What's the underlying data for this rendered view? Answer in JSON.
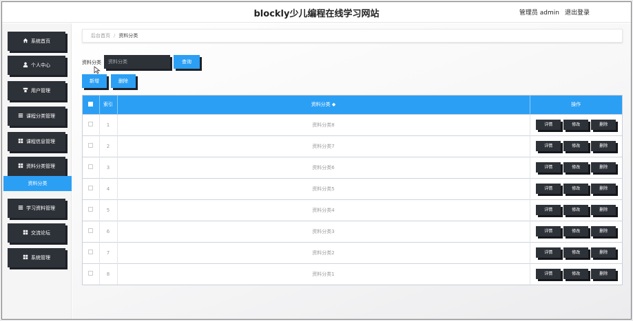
{
  "header": {
    "title": "blockly少儿编程在线学习网站",
    "user_label": "管理员 admin",
    "logout_label": "退出登录"
  },
  "sidebar": {
    "items": [
      {
        "label": "系统首页",
        "icon": "home-icon"
      },
      {
        "label": "个人中心",
        "icon": "user-icon"
      },
      {
        "label": "用户管理",
        "icon": "users-icon"
      },
      {
        "label": "课程分类管理",
        "icon": "list-icon"
      },
      {
        "label": "课程信息管理",
        "icon": "grid-icon"
      },
      {
        "label": "资料分类管理",
        "icon": "grid-icon"
      },
      {
        "label": "学习资料管理",
        "icon": "list-icon"
      },
      {
        "label": "交流论坛",
        "icon": "grid-icon"
      },
      {
        "label": "系统管理",
        "icon": "grid-icon"
      }
    ],
    "active_sub": "资料分类"
  },
  "breadcrumb": {
    "home": "后台首页",
    "separator": "/",
    "current": "资料分类"
  },
  "search": {
    "label": "资料分类",
    "placeholder": "资料分类",
    "button": "查询"
  },
  "actions": {
    "add": "新增",
    "delete": "删除"
  },
  "table": {
    "headers": {
      "index": "索引",
      "category": "资料分类 ◆",
      "operation": "操作"
    },
    "row_buttons": {
      "detail": "详情",
      "edit": "修改",
      "delete": "删除"
    },
    "rows": [
      {
        "index": "1",
        "category": "资料分类8"
      },
      {
        "index": "2",
        "category": "资料分类7"
      },
      {
        "index": "3",
        "category": "资料分类6"
      },
      {
        "index": "4",
        "category": "资料分类5"
      },
      {
        "index": "5",
        "category": "资料分类4"
      },
      {
        "index": "6",
        "category": "资料分类3"
      },
      {
        "index": "7",
        "category": "资料分类2"
      },
      {
        "index": "8",
        "category": "资料分类1"
      }
    ]
  },
  "colors": {
    "accent": "#2b9ff4",
    "dark_button": "#2d3138"
  }
}
